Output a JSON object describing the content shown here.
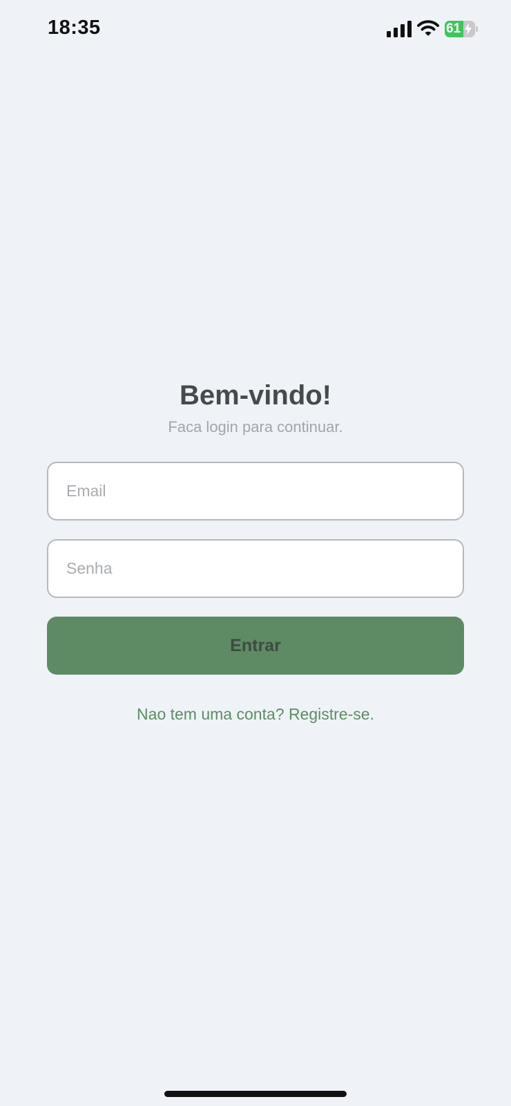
{
  "status_bar": {
    "time": "18:35",
    "battery_level": "61",
    "battery_fraction": 0.61,
    "battery_color": "#3fc55d",
    "signal_icon": "cellular-signal-icon",
    "wifi_icon": "wifi-icon",
    "charging_icon": "lightning-bolt-icon"
  },
  "login": {
    "title": "Bem-vindo!",
    "subtitle": "Faca login para continuar.",
    "email_placeholder": "Email",
    "email_value": "",
    "password_placeholder": "Senha",
    "password_value": "",
    "submit_label": "Entrar",
    "register_link": "Nao tem uma conta? Registre-se."
  },
  "colors": {
    "background": "#eff3f7",
    "accent": "#5e8b64",
    "title_text": "#474a4c",
    "subtitle_text": "#a2a6ab"
  }
}
